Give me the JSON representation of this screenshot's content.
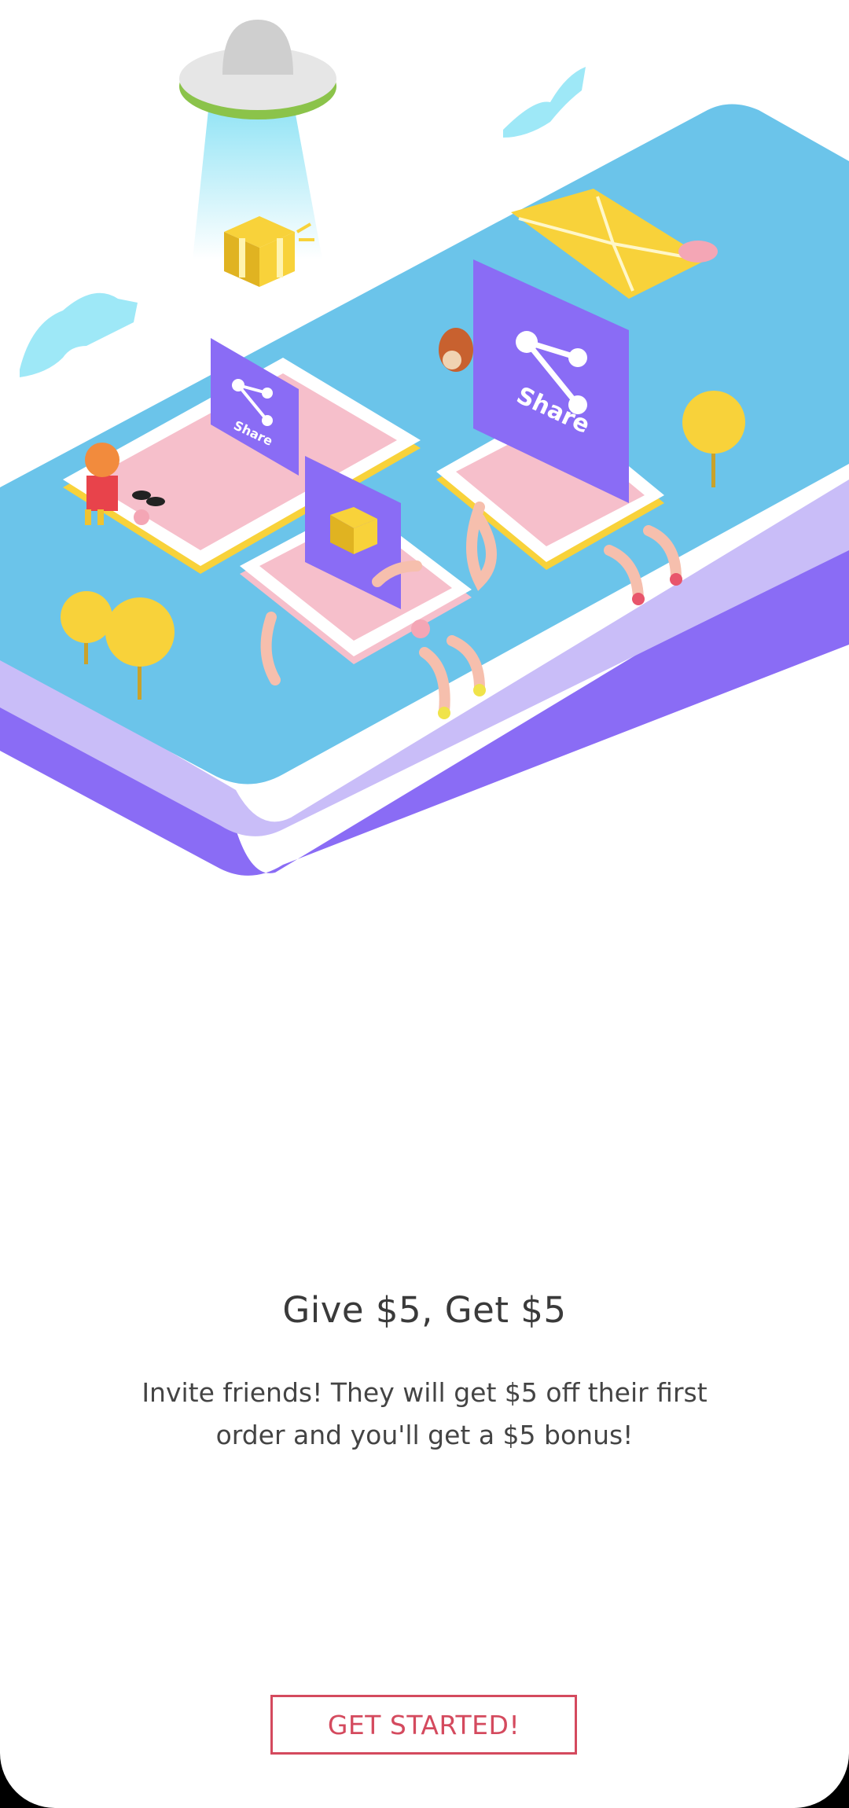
{
  "onboarding": {
    "title": "Give $5, Get $5",
    "subtitle": "Invite friends! They will get $5 off their first order and you'll get a $5 bonus!",
    "cta_label": "GET STARTED!"
  },
  "illustration": {
    "share_label": "Share",
    "colors": {
      "platform_top": "#6bc4ea",
      "platform_mid": "#c9bdf8",
      "platform_bottom": "#8a6cf5",
      "share_card": "#8a6cf5",
      "phone_pink": "#f6bfcb",
      "gold": "#f8d23a",
      "accent_red": "#d44a5e"
    }
  }
}
